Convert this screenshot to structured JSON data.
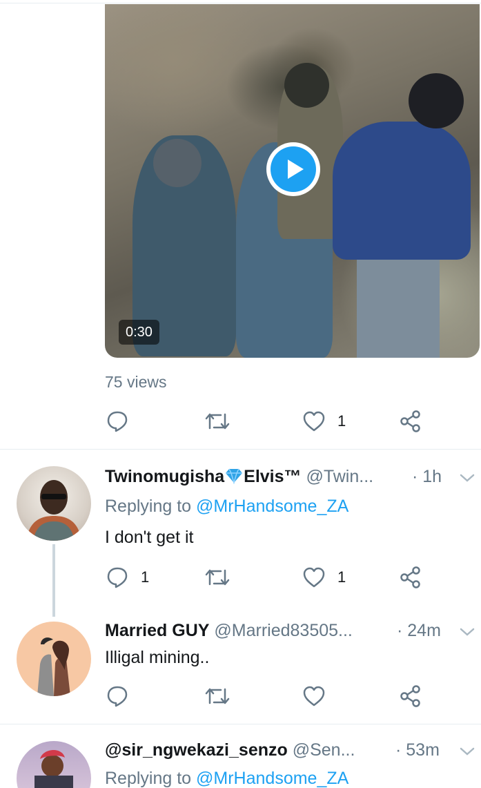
{
  "video": {
    "duration": "0:30",
    "views": "75 views",
    "actions": {
      "reply_count": "",
      "retweet_count": "",
      "like_count": "1"
    }
  },
  "replies": [
    {
      "display_name_part1": "Twinomugisha",
      "display_name_part2": "Elvis™",
      "handle": "@Twin...",
      "time": "· 1h",
      "replying_label": "Replying to",
      "replying_handle": "@MrHandsome_ZA",
      "text": "I don't get it",
      "reply_count": "1",
      "retweet_count": "",
      "like_count": "1"
    },
    {
      "display_name": "Married GUY",
      "handle": "@Married83505...",
      "time": "· 24m",
      "text": "Illigal mining..",
      "reply_count": "",
      "retweet_count": "",
      "like_count": ""
    },
    {
      "display_name": "@sir_ngwekazi_senzo",
      "handle": "@Sen...",
      "time": "· 53m",
      "replying_label": "Replying to",
      "replying_handle": "@MrHandsome_ZA"
    }
  ],
  "colors": {
    "accent": "#1da1f2",
    "muted": "#657786",
    "text": "#14171a",
    "divider": "#e6ecf0"
  },
  "icons": [
    "play-icon",
    "reply-icon",
    "retweet-icon",
    "like-icon",
    "share-icon",
    "chevron-down-icon",
    "gem-emoji"
  ]
}
